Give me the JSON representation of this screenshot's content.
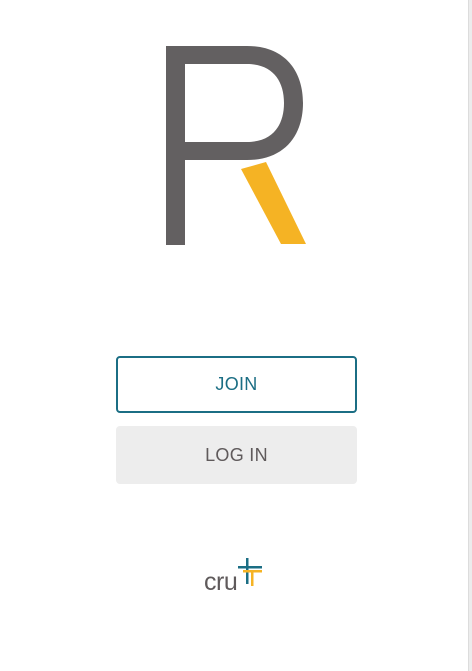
{
  "brand": {
    "logo_letter": "R",
    "logo_primary_color": "#636061",
    "logo_accent_color": "#f5b324"
  },
  "actions": {
    "join_label": "JOIN",
    "login_label": "LOG IN",
    "join_color": "#1b6e84",
    "login_bg": "#ededed"
  },
  "footer": {
    "org_name": "cru",
    "mark_colors": [
      "#1b6e84",
      "#f5b324"
    ]
  },
  "icons": {
    "logo": "r-logo-icon",
    "org_mark": "cross-icon"
  }
}
